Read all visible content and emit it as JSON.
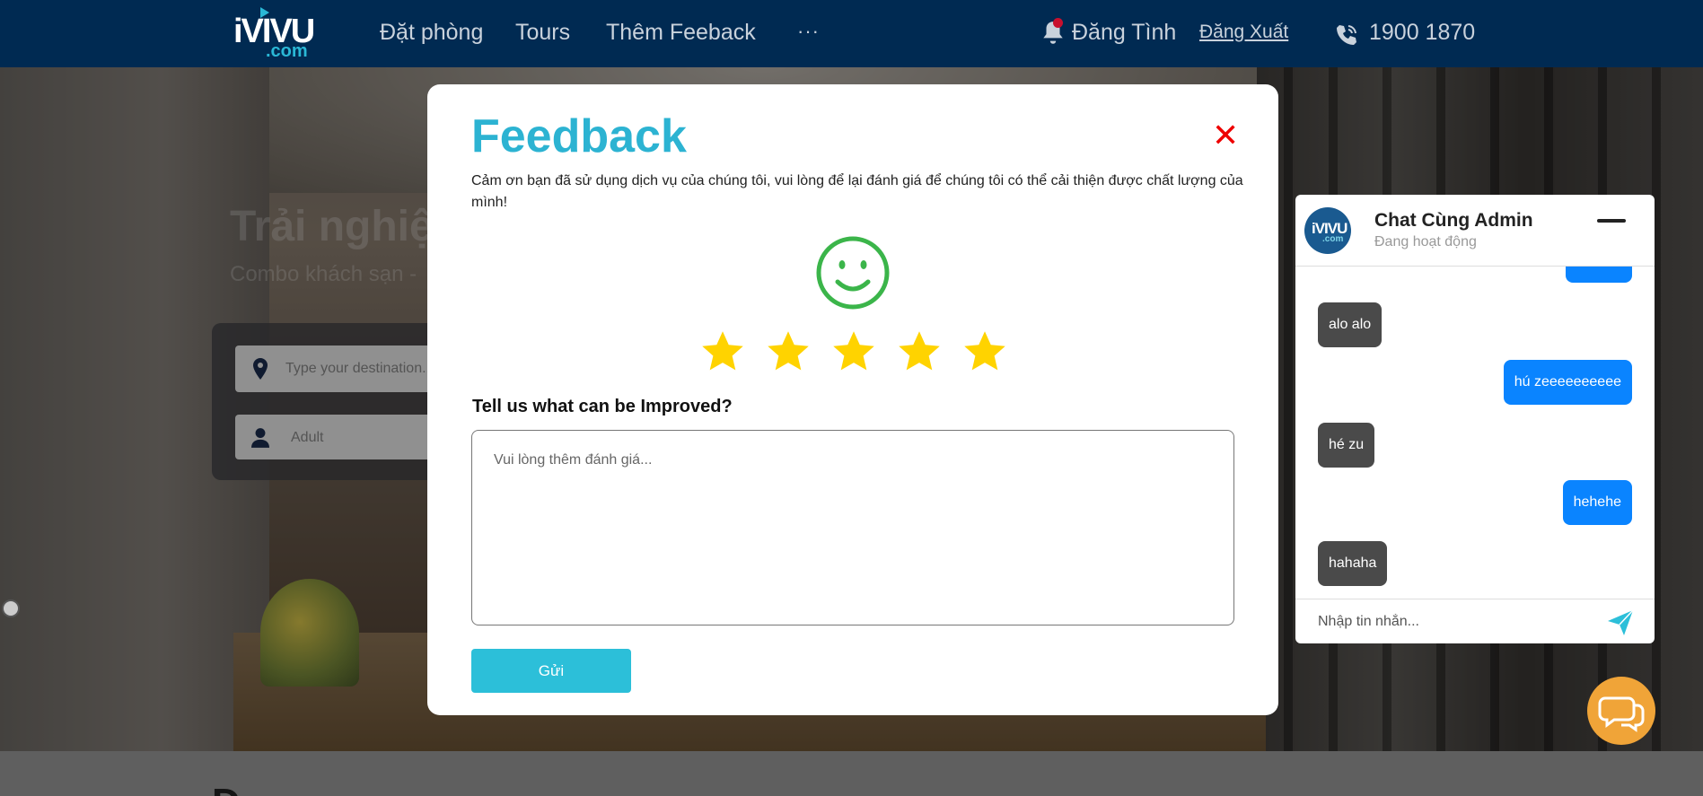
{
  "header": {
    "logo_main": "iVIVU",
    "logo_sub": ".com",
    "nav": [
      "Đặt phòng",
      "Tours",
      "Thêm Feeback"
    ],
    "more": "···",
    "user_name": "Đăng Tình",
    "logout": "Đăng Xuất",
    "phone": "1900 1870"
  },
  "hero": {
    "title": "Trải nghiệ",
    "subtitle": "Combo khách sạn -",
    "destination_placeholder": "Type your destination...",
    "guests_placeholder": "Adult"
  },
  "below": {
    "heading": "Đ..."
  },
  "modal": {
    "title": "Feedback",
    "close": "✕",
    "description": "Cảm ơn bạn đã sử dụng dịch vụ của chúng tôi, vui lòng để lại đánh giá để chúng tôi có thể cải thiện được chất lượng của mình!",
    "rating": 5,
    "rating_max": 5,
    "improve_label": "Tell us what can be Improved?",
    "feedback_placeholder": "Vui lòng thêm đánh giá...",
    "submit": "Gửi"
  },
  "chat": {
    "title": "Chat Cùng Admin",
    "status": "Đang hoạt động",
    "avatar_main": "iVIVU",
    "avatar_sub": ".com",
    "messages": [
      {
        "dir": "in",
        "text": "alo alo"
      },
      {
        "dir": "out",
        "text": "hú zeeeeeeeeee"
      },
      {
        "dir": "in",
        "text": "hé zu"
      },
      {
        "dir": "out",
        "text": "hehehe"
      },
      {
        "dir": "in",
        "text": "hahaha"
      }
    ],
    "input_placeholder": "Nhập tin nhắn..."
  },
  "colors": {
    "header_bg": "#002a52",
    "accent": "#2cb3d2",
    "star": "#ffd300",
    "smiley": "#3bb54a",
    "outgoing_bubble": "#0a84ff",
    "incoming_bubble": "#4a4a4a",
    "fab": "#f0a438",
    "close": "#e00000"
  }
}
